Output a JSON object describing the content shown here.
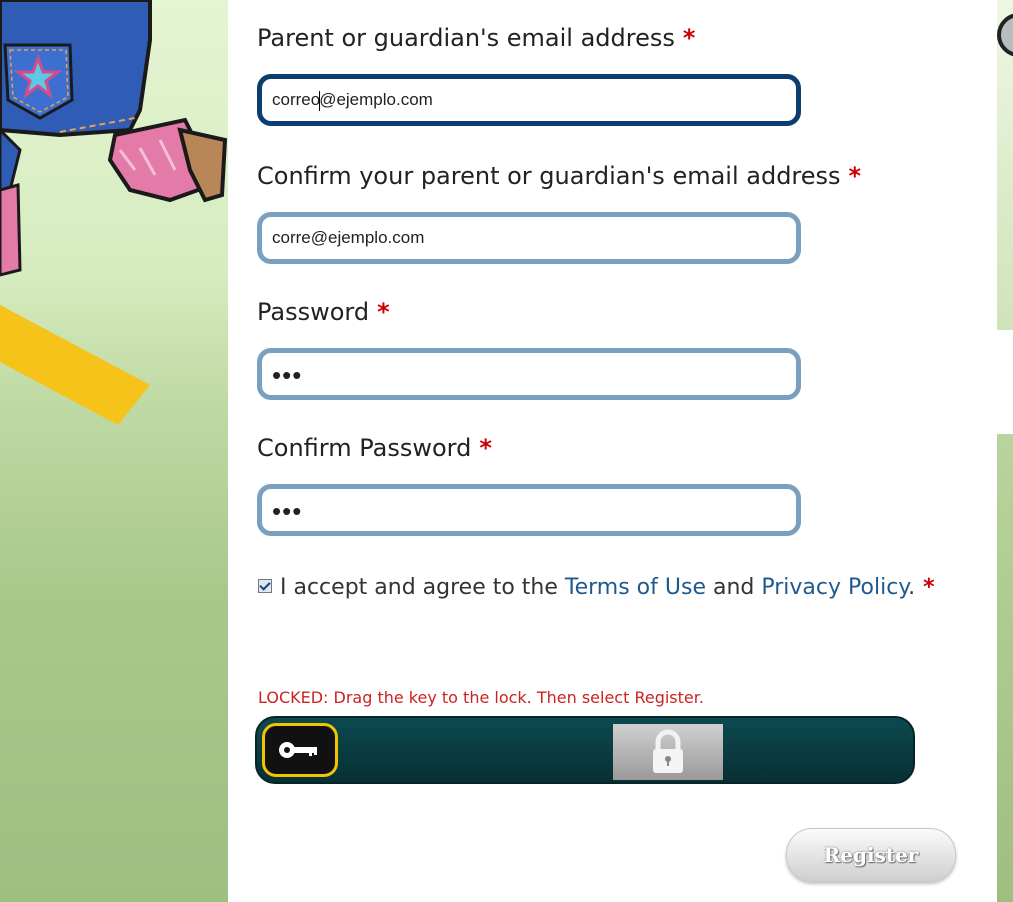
{
  "form": {
    "required_marker": "*",
    "parent_email": {
      "label": "Parent or guardian's email address",
      "value_before_caret": "correo",
      "value_after_caret": "@ejemplo.com"
    },
    "confirm_email": {
      "label": "Confirm your parent or guardian's email address",
      "value": "corre@ejemplo.com"
    },
    "password": {
      "label": "Password",
      "masked_value": "•••"
    },
    "confirm_password": {
      "label": "Confirm Password",
      "masked_value": "•••"
    },
    "consent": {
      "checked": true,
      "text_before": "I accept and agree to the ",
      "terms_link": "Terms of Use",
      "text_middle": " and ",
      "privacy_link": "Privacy Policy",
      "text_after": "."
    },
    "lock": {
      "message": "LOCKED: Drag the key to the lock. Then select Register."
    },
    "register_label": "Register"
  },
  "colors": {
    "required": "#cc0000",
    "link": "#1f5a8f",
    "focused_border": "#0b3d6e",
    "input_border": "#7b9fbf",
    "lock_track": "#0a3c42",
    "key_border": "#f2c300"
  },
  "icons": {
    "key": "key-icon",
    "lock": "padlock-icon"
  }
}
